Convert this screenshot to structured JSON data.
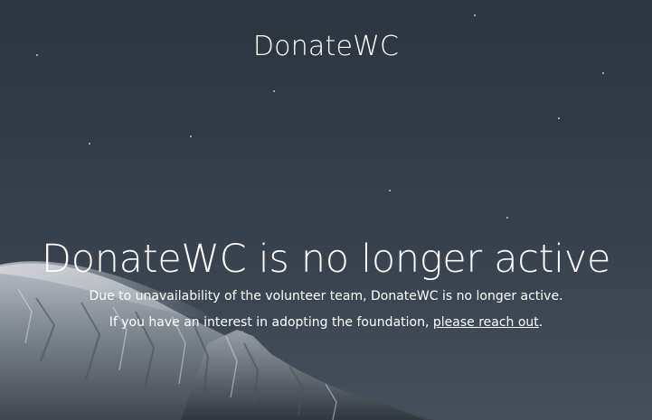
{
  "header": {
    "brand": "DonateWC"
  },
  "main": {
    "headline": "DonateWC is no longer active",
    "line1": "Due to unavailability of the volunteer team, DonateWC is no longer active.",
    "line2_prefix": "If you have an interest in adopting the foundation, ",
    "line2_link": "please reach out",
    "line2_suffix": "."
  },
  "colors": {
    "sky": "#323b47",
    "text": "#ffffff"
  },
  "background": {
    "description_icon": "starry-mountain-image"
  }
}
